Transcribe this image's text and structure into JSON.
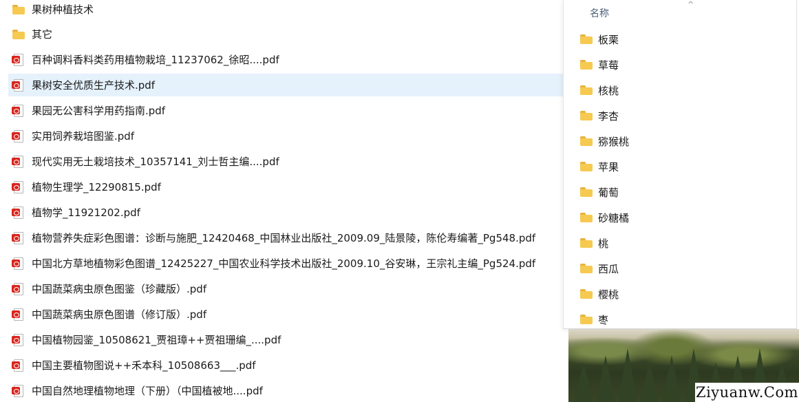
{
  "files": [
    {
      "type": "folder",
      "label": "果树种植技术"
    },
    {
      "type": "folder",
      "label": "其它"
    },
    {
      "type": "pdf",
      "label": "百种调料香料类药用植物栽培_11237062_徐昭....pdf"
    },
    {
      "type": "pdf",
      "label": "果树安全优质生产技术.pdf",
      "selected": true
    },
    {
      "type": "pdf",
      "label": "果园无公害科学用药指南.pdf"
    },
    {
      "type": "pdf",
      "label": "实用饲养栽培图鉴.pdf"
    },
    {
      "type": "pdf",
      "label": "现代实用无土栽培技术_10357141_刘士哲主编....pdf"
    },
    {
      "type": "pdf",
      "label": "植物生理学_12290815.pdf"
    },
    {
      "type": "pdf",
      "label": "植物学_11921202.pdf"
    },
    {
      "type": "pdf",
      "label": "植物营养失症彩色图谱：诊断与施肥_12420468_中国林业出版社_2009.09_陆景陵，陈伦寿编著_Pg548.pdf"
    },
    {
      "type": "pdf",
      "label": "中国北方草地植物彩色图谱_12425227_中国农业科学技术出版社_2009.10_谷安琳，王宗礼主编_Pg524.pdf"
    },
    {
      "type": "pdf",
      "label": "中国蔬菜病虫原色图鉴（珍藏版）.pdf"
    },
    {
      "type": "pdf",
      "label": "中国蔬菜病虫原色图谱（修订版）.pdf"
    },
    {
      "type": "pdf",
      "label": "中国植物园鉴_10508621_贾祖璋++贾祖珊编_....pdf"
    },
    {
      "type": "pdf",
      "label": "中国主要植物图说++禾本科_10508663___.pdf"
    },
    {
      "type": "pdf",
      "label": "中国自然地理植物地理（下册）（中国植被地....pdf"
    }
  ],
  "panel": {
    "column_header": "名称",
    "sort_indicator": "^",
    "folders": [
      "板栗",
      "草莓",
      "核桃",
      "李杏",
      "猕猴桃",
      "苹果",
      "葡萄",
      "砂糖橘",
      "桃",
      "西瓜",
      "樱桃",
      "枣"
    ]
  },
  "watermark": "Ziyuanw.Com",
  "colors": {
    "selected_row": "#e5f1fb",
    "folder": "#f6c951",
    "pdf_red": "#d9251d"
  }
}
